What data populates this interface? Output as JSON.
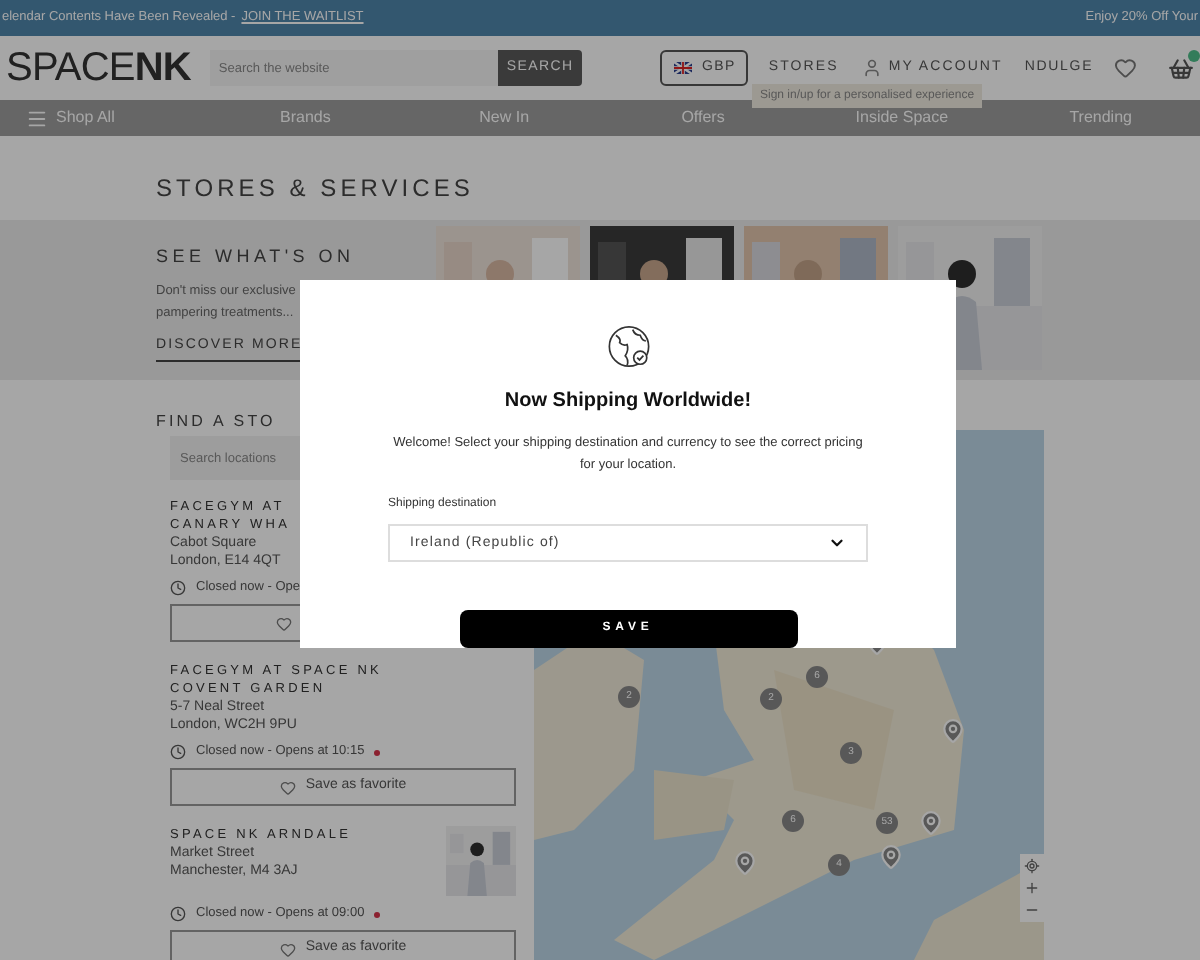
{
  "top_banner": {
    "message": "elendar Contents Have Been Revealed -",
    "link": "JOIN THE WAITLIST",
    "promo": "Enjoy 20% Off Your"
  },
  "header": {
    "logo_light": "SPACE",
    "logo_bold": "NK",
    "search": {
      "placeholder": "Search the website",
      "button": "SEARCH"
    },
    "currency": "GBP",
    "stores_link": "STORES",
    "account_link": "MY ACCOUNT",
    "loyalty_link": "NDULGE",
    "tooltip": "Sign in/up for a personalised experience"
  },
  "nav": [
    {
      "label": "Shop All"
    },
    {
      "label": "Brands"
    },
    {
      "label": "New In"
    },
    {
      "label": "Offers"
    },
    {
      "label": "Inside Space"
    },
    {
      "label": "Trending"
    }
  ],
  "page_title": "STORES & SERVICES",
  "whats_on": {
    "title": "SEE WHAT'S ON",
    "description_lines": [
      "Don't miss our exclusive",
      "pampering treatments..."
    ],
    "link": "DISCOVER MORE",
    "photos": [
      {
        "kind": "picture"
      },
      {
        "kind": "picture"
      },
      {
        "kind": "picture"
      },
      {
        "kind": "picture"
      }
    ]
  },
  "find_store": {
    "title": "FIND A STO",
    "search_placeholder": "Search locations",
    "stores": [
      {
        "name_lines": [
          "FACEGYM AT",
          "CANARY WHA"
        ],
        "address_lines": [
          "Cabot Square",
          "London, E14 4QT"
        ],
        "hours": "Closed now - Ope"
      },
      {
        "name_lines": [
          "FACEGYM AT SPACE NK",
          "COVENT GARDEN"
        ],
        "address_lines": [
          "5-7 Neal Street",
          "London, WC2H 9PU"
        ],
        "hours": "Closed now - Opens at 10:15",
        "open": false,
        "favorite_label": "Save as favorite",
        "has_photo": false
      },
      {
        "name_lines": [
          "SPACE NK ARNDALE"
        ],
        "address_lines": [
          "Market Street",
          "Manchester, M4 3AJ"
        ],
        "hours": "Closed now - Opens at 09:00",
        "open": false,
        "favorite_label": "Save as favorite",
        "has_photo": true
      }
    ]
  },
  "map": {
    "clusters": [
      {
        "count": "2"
      },
      {
        "count": "2"
      },
      {
        "count": "6"
      },
      {
        "count": "3"
      },
      {
        "count": "6"
      },
      {
        "count": "53"
      },
      {
        "count": "4"
      }
    ]
  },
  "modal": {
    "title": "Now Shipping Worldwide!",
    "message": "Welcome! Select your shipping destination and currency to see the correct pricing for your location.",
    "field_label": "Shipping destination",
    "destination": "Ireland (Republic of)",
    "save_button": "SAVE"
  }
}
